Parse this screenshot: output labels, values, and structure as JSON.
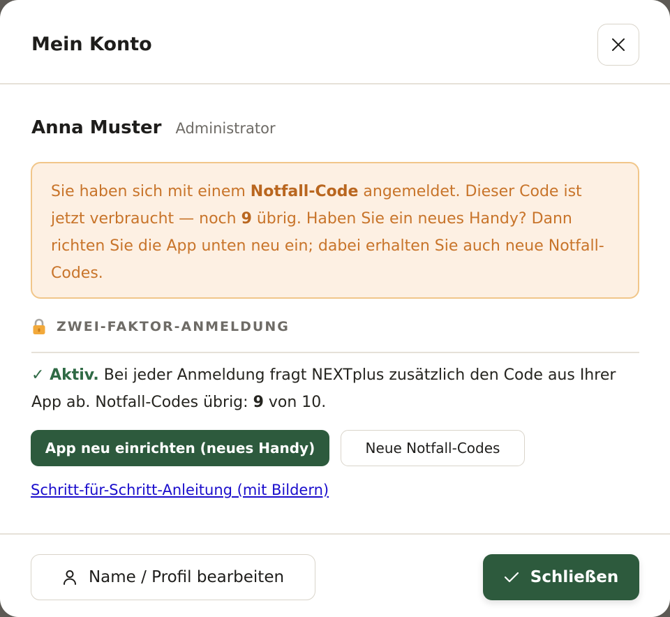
{
  "dialog": {
    "title": "Mein Konto"
  },
  "user": {
    "name": "Anna Muster",
    "role": "Administrator"
  },
  "notice": {
    "text_1": "Sie haben sich mit einem ",
    "emphasis_1": "Notfall-Code",
    "text_2": " angemeldet. Dieser Code ist jetzt verbraucht — noch ",
    "emphasis_2": "9",
    "text_3": " übrig. Haben Sie ein neues Handy? Dann richten Sie die App unten neu ein; dabei erhalten Sie auch neue Notfall-Codes."
  },
  "two_factor": {
    "section_title": "ZWEI-FAKTOR-ANMELDUNG",
    "status_label": "✓ Aktiv.",
    "status_text_1": " Bei jeder Anmeldung fragt NEXTplus zusätzlich den Code aus Ihrer App ab. Notfall-Codes übrig: ",
    "codes_left": "9",
    "status_text_2": " von 10.",
    "reset_app_label": "App neu einrichten (neues Handy)",
    "new_codes_label": "Neue Notfall-Codes",
    "guide_link_label": "Schritt-für-Schritt-Anleitung (mit Bildern)"
  },
  "footer": {
    "edit_profile_label": "Name / Profil bearbeiten",
    "close_label": "Schließen"
  },
  "colors": {
    "primary": "#2d5a3d",
    "notice_bg": "#fdf0e3",
    "notice_border": "#f1c68a",
    "notice_text": "#c8742a",
    "link": "#1a0dcc"
  }
}
